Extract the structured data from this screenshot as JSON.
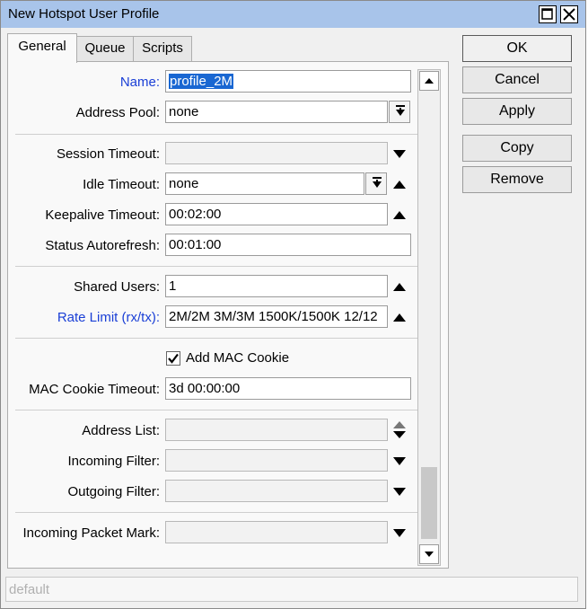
{
  "window": {
    "title": "New Hotspot User Profile"
  },
  "tabs": [
    {
      "label": "General",
      "active": true
    },
    {
      "label": "Queue",
      "active": false
    },
    {
      "label": "Scripts",
      "active": false
    }
  ],
  "buttons": {
    "ok": "OK",
    "cancel": "Cancel",
    "apply": "Apply",
    "copy": "Copy",
    "remove": "Remove"
  },
  "fields": {
    "name": {
      "label": "Name:",
      "value": "profile_2M"
    },
    "address_pool": {
      "label": "Address Pool:",
      "value": "none"
    },
    "session_timeout": {
      "label": "Session Timeout:",
      "value": ""
    },
    "idle_timeout": {
      "label": "Idle Timeout:",
      "value": "none"
    },
    "keepalive_timeout": {
      "label": "Keepalive Timeout:",
      "value": "00:02:00"
    },
    "status_autorefresh": {
      "label": "Status Autorefresh:",
      "value": "00:01:00"
    },
    "shared_users": {
      "label": "Shared Users:",
      "value": "1"
    },
    "rate_limit": {
      "label": "Rate Limit (rx/tx):",
      "value": "2M/2M 3M/3M 1500K/1500K 12/12"
    },
    "add_mac_cookie": {
      "label": "Add MAC Cookie",
      "checked": true
    },
    "mac_cookie_timeout": {
      "label": "MAC Cookie Timeout:",
      "value": "3d 00:00:00"
    },
    "address_list": {
      "label": "Address List:",
      "value": ""
    },
    "incoming_filter": {
      "label": "Incoming Filter:",
      "value": ""
    },
    "outgoing_filter": {
      "label": "Outgoing Filter:",
      "value": ""
    },
    "incoming_packet_mark": {
      "label": "Incoming Packet Mark:",
      "value": ""
    }
  },
  "status_bar": {
    "text": "default"
  },
  "colors": {
    "titlebar": "#a8c4ea",
    "link_label": "#1a3fd6",
    "selection": "#1967d2"
  }
}
